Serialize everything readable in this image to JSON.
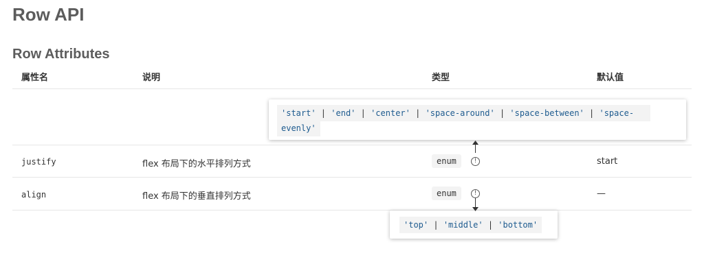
{
  "page": {
    "title": "Row API",
    "section_title": "Row Attributes"
  },
  "table": {
    "headers": [
      "属性名",
      "说明",
      "类型",
      "默认值"
    ],
    "rows": [
      {
        "name": "justify",
        "desc": "flex 布局下的水平排列方式",
        "type": "enum",
        "default": "start"
      },
      {
        "name": "align",
        "desc": "flex 布局下的垂直排列方式",
        "type": "enum",
        "default": "—"
      }
    ]
  },
  "tooltips": {
    "justify": {
      "line1_parts": [
        "'start'",
        " | ",
        "'end'",
        " | ",
        "'center'",
        " | ",
        "'space-around'",
        " | ",
        "'space-between'",
        " | ",
        "'space-"
      ],
      "line2": "evenly'"
    },
    "align": {
      "parts": [
        "'top'",
        " | ",
        "'middle'",
        " | ",
        "'bottom'"
      ]
    }
  },
  "icons": {
    "info": "info-circle-icon"
  },
  "colors": {
    "code_text": "#1e5b8f",
    "code_bg": "#f3f3f3",
    "heading": "#5c5c5c"
  }
}
